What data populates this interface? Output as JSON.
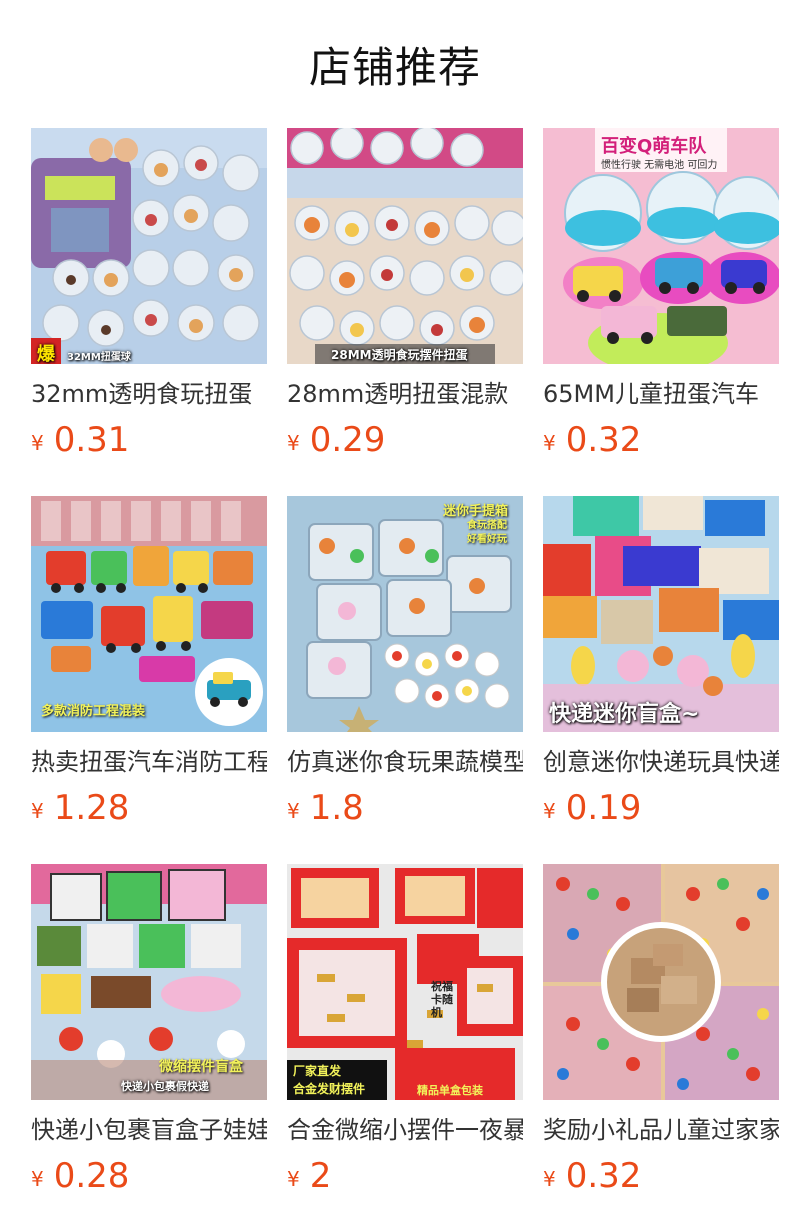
{
  "page": {
    "title": "店铺推荐"
  },
  "products": [
    {
      "name": "32mm透明食玩扭蛋",
      "currency": "¥",
      "price": "0.31",
      "image": {
        "icon": "gacha-food-capsules",
        "overlays": [
          "爆",
          "32MM扭蛋球"
        ],
        "bg": "#b8cfe8"
      }
    },
    {
      "name": "28mm透明扭蛋混款",
      "currency": "¥",
      "price": "0.29",
      "image": {
        "icon": "gacha-food-capsules",
        "overlays": [
          "28MM透明食玩摆件扭蛋"
        ],
        "bg": "#e8d8c8"
      }
    },
    {
      "name": "65MM儿童扭蛋汽车",
      "currency": "¥",
      "price": "0.32",
      "image": {
        "icon": "gacha-toy-cars",
        "overlays": [
          "百变Q萌车队",
          "惯性行驶 无需电池 可回力"
        ],
        "bg": "#f5bdd2"
      }
    },
    {
      "name": "热卖扭蛋汽车消防工程",
      "currency": "¥",
      "price": "1.28",
      "image": {
        "icon": "toy-trucks",
        "overlays": [
          "多款消防工程混装"
        ],
        "bg": "#8fc3e6"
      }
    },
    {
      "name": "仿真迷你食玩果蔬模型",
      "currency": "¥",
      "price": "1.8",
      "image": {
        "icon": "mini-food-boxes",
        "overlays": [
          "迷你手提箱",
          "食玩搭配",
          "好看好玩"
        ],
        "bg": "#a7c7dc"
      }
    },
    {
      "name": "创意迷你快递玩具快递",
      "currency": "¥",
      "price": "0.19",
      "image": {
        "icon": "mini-delivery-boxes",
        "overlays": [
          "快递迷你盲盒~"
        ],
        "bg": "#b7d8ec"
      }
    },
    {
      "name": "快递小包裹盲盒子娃娃",
      "currency": "¥",
      "price": "0.28",
      "image": {
        "icon": "mini-parcels",
        "overlays": [
          "微缩摆件盲盒",
          "快递小包裹假快递"
        ],
        "bg": "#c5d9ea"
      }
    },
    {
      "name": "合金微缩小摆件一夜暴富",
      "currency": "¥",
      "price": "2",
      "image": {
        "icon": "red-gift-boxes",
        "overlays": [
          "祝福卡随机",
          "厂家直发",
          "合金发财摆件",
          "精品单盒包装"
        ],
        "bg": "#e9e9e9"
      }
    },
    {
      "name": "奖励小礼品儿童过家家",
      "currency": "¥",
      "price": "0.32",
      "image": {
        "icon": "mini-toys-collage",
        "overlays": [],
        "bg": "#e8c89a"
      }
    }
  ]
}
